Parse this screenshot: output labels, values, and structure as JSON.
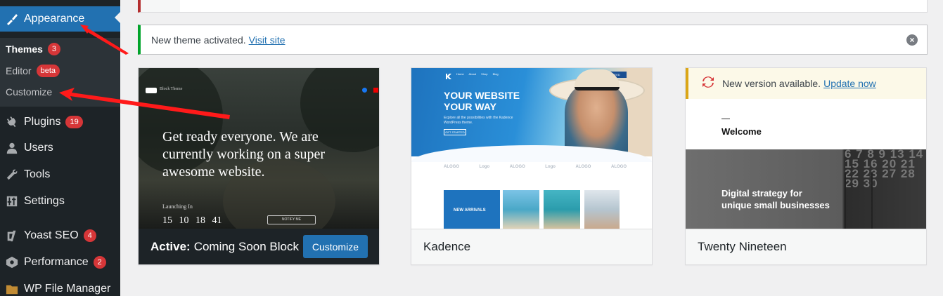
{
  "sidebar": {
    "appearance": "Appearance",
    "submenu": {
      "themes": "Themes",
      "themes_count": "3",
      "editor": "Editor",
      "editor_badge": "beta",
      "customize": "Customize"
    },
    "plugins": "Plugins",
    "plugins_count": "19",
    "users": "Users",
    "tools": "Tools",
    "settings": "Settings",
    "yoast": "Yoast SEO",
    "yoast_count": "4",
    "performance": "Performance",
    "performance_count": "2",
    "filemanager": "WP File Manager"
  },
  "notice": {
    "text": "New theme activated.",
    "link": "Visit site",
    "dismiss": "×"
  },
  "themes": [
    {
      "active_label": "Active:",
      "name": "Coming Soon Block",
      "button": "Customize",
      "screenshot": {
        "brand": "Block Theme",
        "headline": "Get ready everyone. We are currently working on a super awesome website.",
        "launching": "Launching In",
        "countdown": "15 10 18 41",
        "notify": "NOTIFY ME"
      }
    },
    {
      "name": "Kadence",
      "screenshot": {
        "nav": "Home About Shop Blog",
        "nav_button": "GET STARTED",
        "headline_1": "YOUR WEBSITE",
        "headline_2": "YOUR WAY",
        "subtext": "Explore all the possibilities with the Kadence WordPress theme.",
        "cta": "GET STARTED",
        "logos": [
          "ALOGO",
          "Logo",
          "ALOGO",
          "Logo",
          "ALOGO",
          "ALOGO"
        ],
        "tile_label": "NEW ARRIVALS"
      }
    },
    {
      "name": "Twenty Nineteen",
      "update_text": "New version available.",
      "update_link": "Update now",
      "screenshot": {
        "welcome": "Welcome",
        "tagline_1": "Digital strategy for",
        "tagline_2": "unique small businesses",
        "calendar": "6 7 8 9 13 14 15 16 20 21 22 23 27 28 29 30"
      }
    }
  ],
  "colors": {
    "admin_bar": "#1d2327",
    "accent": "#2271b1",
    "badge": "#d63638",
    "notice_success": "#00a32a",
    "annotation_arrow": "#ff1a1a"
  }
}
